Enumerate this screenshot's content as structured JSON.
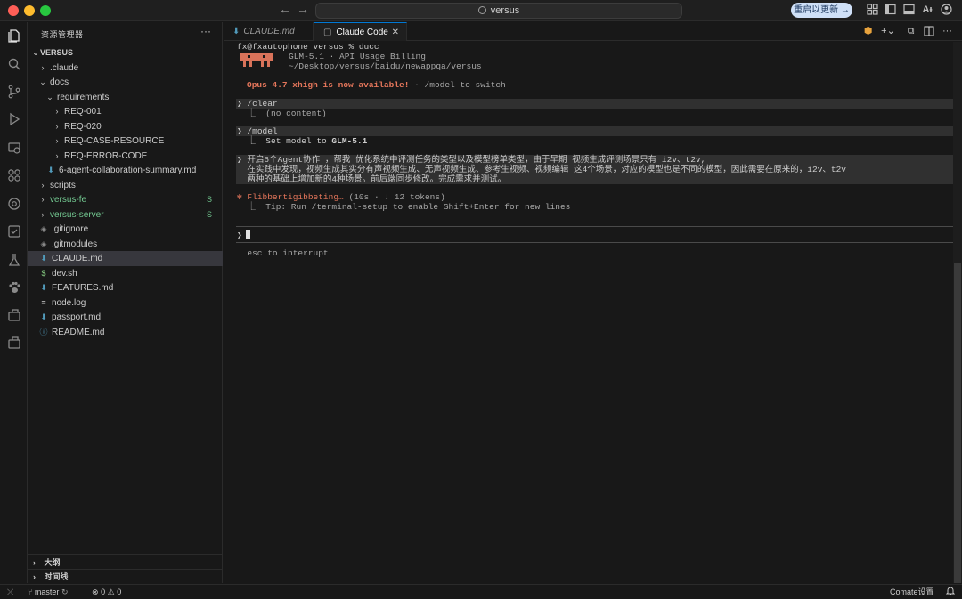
{
  "titlebar": {
    "search_text": "versus",
    "update_button": "重启以更新 →"
  },
  "sidebar": {
    "header": "资源管理器",
    "more": "···",
    "root": "VERSUS",
    "items": [
      {
        "label": ".claude",
        "indent": 1,
        "type": "folder",
        "open": false
      },
      {
        "label": "docs",
        "indent": 1,
        "type": "folder",
        "open": true
      },
      {
        "label": "requirements",
        "indent": 2,
        "type": "folder",
        "open": true
      },
      {
        "label": "REQ-001",
        "indent": 3,
        "type": "folder",
        "open": false
      },
      {
        "label": "REQ-020",
        "indent": 3,
        "type": "folder",
        "open": false
      },
      {
        "label": "REQ-CASE-RESOURCE",
        "indent": 3,
        "type": "folder",
        "open": false
      },
      {
        "label": "REQ-ERROR-CODE",
        "indent": 3,
        "type": "folder",
        "open": false
      },
      {
        "label": "6-agent-collaboration-summary.md",
        "indent": 2,
        "type": "md"
      },
      {
        "label": "scripts",
        "indent": 1,
        "type": "folder",
        "open": false
      },
      {
        "label": "versus-fe",
        "indent": 1,
        "type": "folder",
        "open": false,
        "badge": "S",
        "color": "#73c991"
      },
      {
        "label": "versus-server",
        "indent": 1,
        "type": "folder",
        "open": false,
        "badge": "S",
        "color": "#73c991"
      },
      {
        "label": ".gitignore",
        "indent": 1,
        "type": "git"
      },
      {
        "label": ".gitmodules",
        "indent": 1,
        "type": "git"
      },
      {
        "label": "CLAUDE.md",
        "indent": 1,
        "type": "md",
        "selected": true
      },
      {
        "label": "dev.sh",
        "indent": 1,
        "type": "sh"
      },
      {
        "label": "FEATURES.md",
        "indent": 1,
        "type": "md"
      },
      {
        "label": "node.log",
        "indent": 1,
        "type": "log"
      },
      {
        "label": "passport.md",
        "indent": 1,
        "type": "md"
      },
      {
        "label": "README.md",
        "indent": 1,
        "type": "info"
      }
    ],
    "outline": "大纲",
    "timeline": "时间线"
  },
  "tabs": [
    {
      "label": "CLAUDE.md",
      "active": false
    },
    {
      "label": "Claude Code",
      "active": true
    }
  ],
  "terminal": {
    "prompt": "fx@fxautophone versus % ducc",
    "header_line1": "GLM-5.1 · API Usage Billing",
    "header_line2": "~/Desktop/versus/baidu/newappqa/versus",
    "opus_notice": "Opus 4.7 xhigh is now available!",
    "opus_suffix": " · /model to switch",
    "cmd_clear": "❯ /clear",
    "clear_out": "  ⎿  (no content)",
    "cmd_model": "❯ /model",
    "model_out_prefix": "  ⎿  Set model to ",
    "model_out_value": "GLM-5.1",
    "user_msg1": "❯ 开启6个Agent协作 ，帮我 优化系统中评测任务的类型以及模型榜单类型，由于早期 视频生成评测场景只有 i2v、t2v,",
    "user_msg2": "  在实践中发现，视频生成其实分有声视频生成、无声视频生成、参考生视频、视频编辑 这4个场景，对应的模型也是不同的模型，因此需要在原来的，i2v、t2v",
    "user_msg3": "  两种的基础上增加新的4种场景。前后端同步修改。完成需求并测试。",
    "status_word": "✻ Flibbertigibbeting…",
    "status_meta": " (10s · ↓ 12 tokens)",
    "tip": "  ⎿  Tip: Run /terminal-setup to enable Shift+Enter for new lines",
    "input_prompt": "❯",
    "hint": "  esc to interrupt"
  },
  "statusbar": {
    "branch": "master",
    "errors": "0",
    "warnings": "0",
    "right": "Comate设置"
  }
}
